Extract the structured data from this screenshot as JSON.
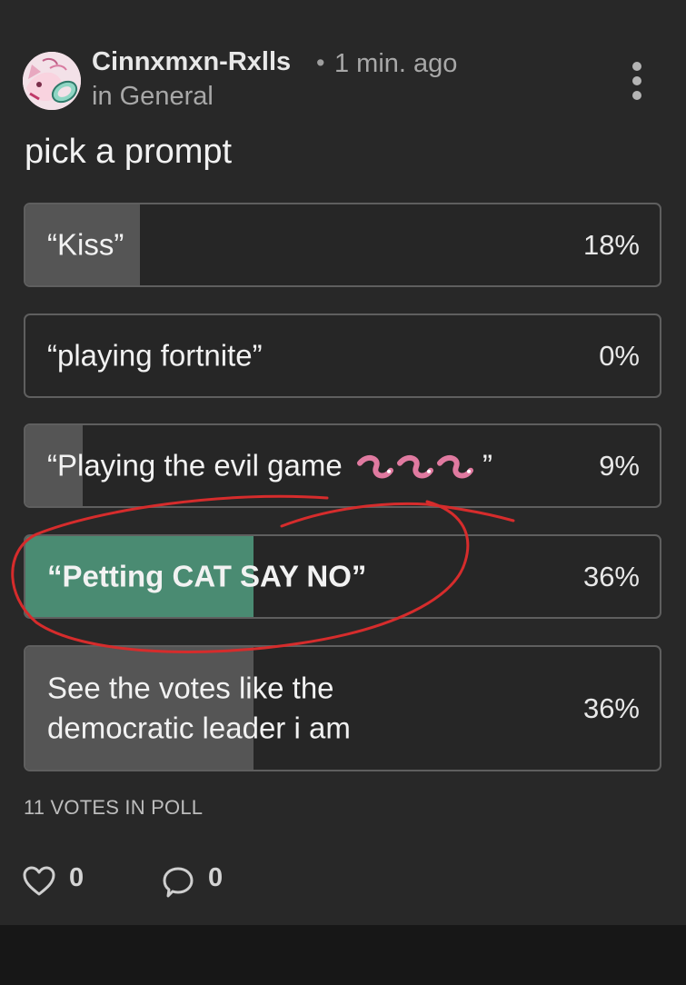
{
  "post": {
    "author": "Cinnxmxn-Rxlls",
    "separator": "•",
    "time": "1 min. ago",
    "community": "in General",
    "avatar_icon": "avatar-image",
    "more_icon": "vertical-ellipsis-icon",
    "title": "pick a prompt"
  },
  "poll": {
    "options": [
      {
        "label": "“Kiss”",
        "percent_label": "18%",
        "percent": 18,
        "selected": false
      },
      {
        "label": "“playing fortnite”",
        "percent_label": "0%",
        "percent": 0,
        "selected": false
      },
      {
        "label": "“Playing the evil game",
        "label_end": "”",
        "percent_label": "9%",
        "percent": 9,
        "selected": false
      },
      {
        "label": "“Petting CAT SAY NO”",
        "percent_label": "36%",
        "percent": 36,
        "selected": true
      },
      {
        "label": "See the votes like the democratic leader i am",
        "percent_label": "36%",
        "percent": 36,
        "selected": false
      }
    ],
    "vote_count": "11 VOTES IN POLL",
    "selected_color": "#4a8b72",
    "unselected_fill_color": "#555555",
    "annotation_color": "#d62c2c"
  },
  "actions": {
    "likes": "0",
    "comments": "0",
    "like_icon": "heart-icon",
    "comment_icon": "speech-bubble-icon"
  }
}
